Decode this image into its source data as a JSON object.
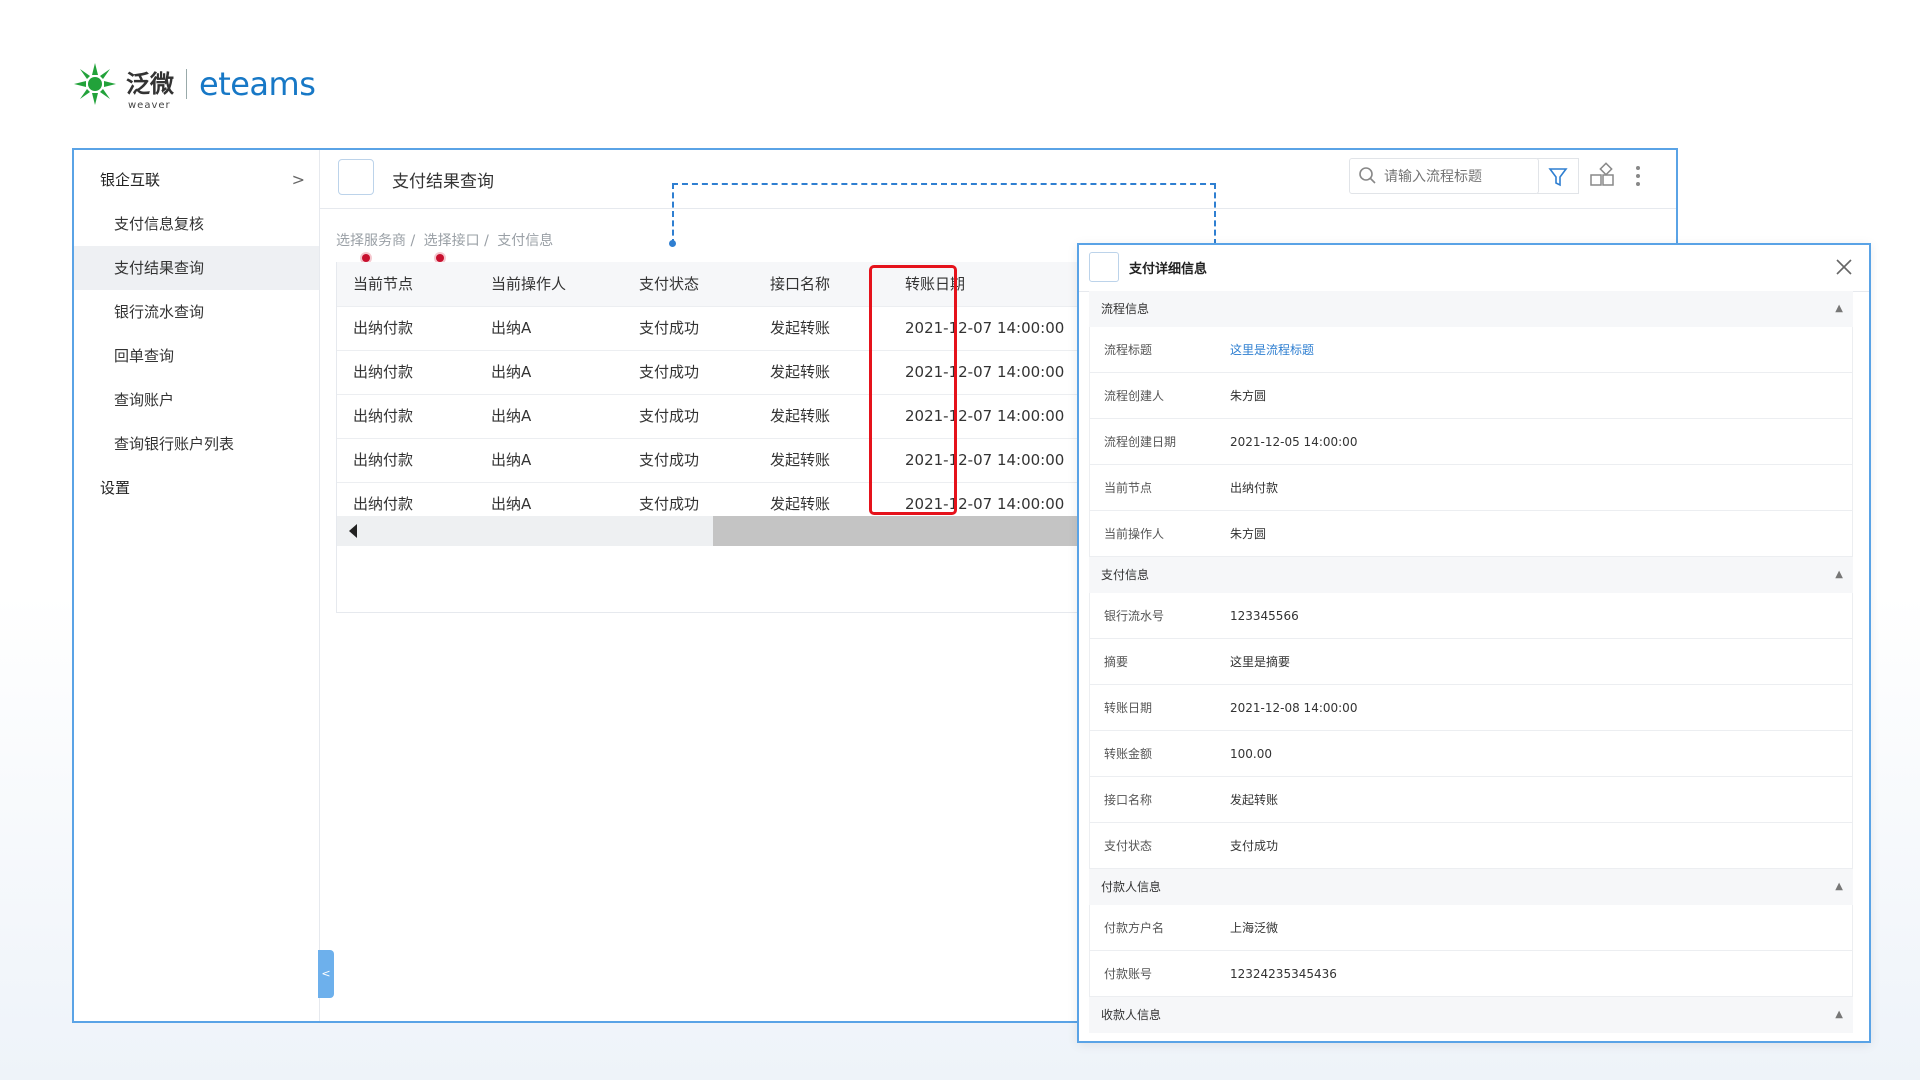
{
  "logo": {
    "cn": "泛微",
    "sub": "weaver",
    "en": "eteams"
  },
  "sidebar": {
    "group": "银企互联",
    "items": [
      {
        "label": "支付信息复核"
      },
      {
        "label": "支付结果查询"
      },
      {
        "label": "银行流水查询"
      },
      {
        "label": "回单查询"
      },
      {
        "label": "查询账户"
      },
      {
        "label": "查询银行账户列表"
      }
    ],
    "settings": "设置"
  },
  "header": {
    "title": "支付结果查询",
    "search_placeholder": "请输入流程标题"
  },
  "breadcrumb": [
    "选择服务商 /",
    "选择接口 /",
    "支付信息"
  ],
  "table": {
    "columns": [
      "当前节点",
      "当前操作人",
      "支付状态",
      "接口名称",
      "转账日期"
    ],
    "rows": [
      [
        "出纳付款",
        "出纳A",
        "支付成功",
        "发起转账",
        "2021-12-07 14:00:00"
      ],
      [
        "出纳付款",
        "出纳A",
        "支付成功",
        "发起转账",
        "2021-12-07 14:00:00"
      ],
      [
        "出纳付款",
        "出纳A",
        "支付成功",
        "发起转账",
        "2021-12-07 14:00:00"
      ],
      [
        "出纳付款",
        "出纳A",
        "支付成功",
        "发起转账",
        "2021-12-07 14:00:00"
      ],
      [
        "出纳付款",
        "出纳A",
        "支付成功",
        "发起转账",
        "2021-12-07 14:00:00"
      ]
    ]
  },
  "detail": {
    "title": "支付详细信息",
    "sections": [
      {
        "name": "流程信息",
        "fields": [
          {
            "label": "流程标题",
            "value": "这里是流程标题"
          },
          {
            "label": "流程创建人",
            "value": "朱方圆"
          },
          {
            "label": "流程创建日期",
            "value": "2021-12-05 14:00:00"
          },
          {
            "label": "当前节点",
            "value": "出纳付款"
          },
          {
            "label": "当前操作人",
            "value": "朱方圆"
          }
        ]
      },
      {
        "name": "支付信息",
        "fields": [
          {
            "label": "银行流水号",
            "value": "123345566"
          },
          {
            "label": "摘要",
            "value": "这里是摘要"
          },
          {
            "label": "转账日期",
            "value": "2021-12-08 14:00:00"
          },
          {
            "label": "转账金额",
            "value": "100.00"
          },
          {
            "label": "接口名称",
            "value": "发起转账"
          },
          {
            "label": "支付状态",
            "value": "支付成功"
          }
        ]
      },
      {
        "name": "付款人信息",
        "fields": [
          {
            "label": "付款方户名",
            "value": "上海泛微"
          },
          {
            "label": "付款账号",
            "value": "12324235345436"
          }
        ]
      },
      {
        "name": "收款人信息",
        "fields": []
      }
    ]
  },
  "colors": {
    "accent": "#2f7fd1",
    "border": "#5aa3e6",
    "highlight": "#e5121b",
    "brand_green": "#22a23a"
  }
}
